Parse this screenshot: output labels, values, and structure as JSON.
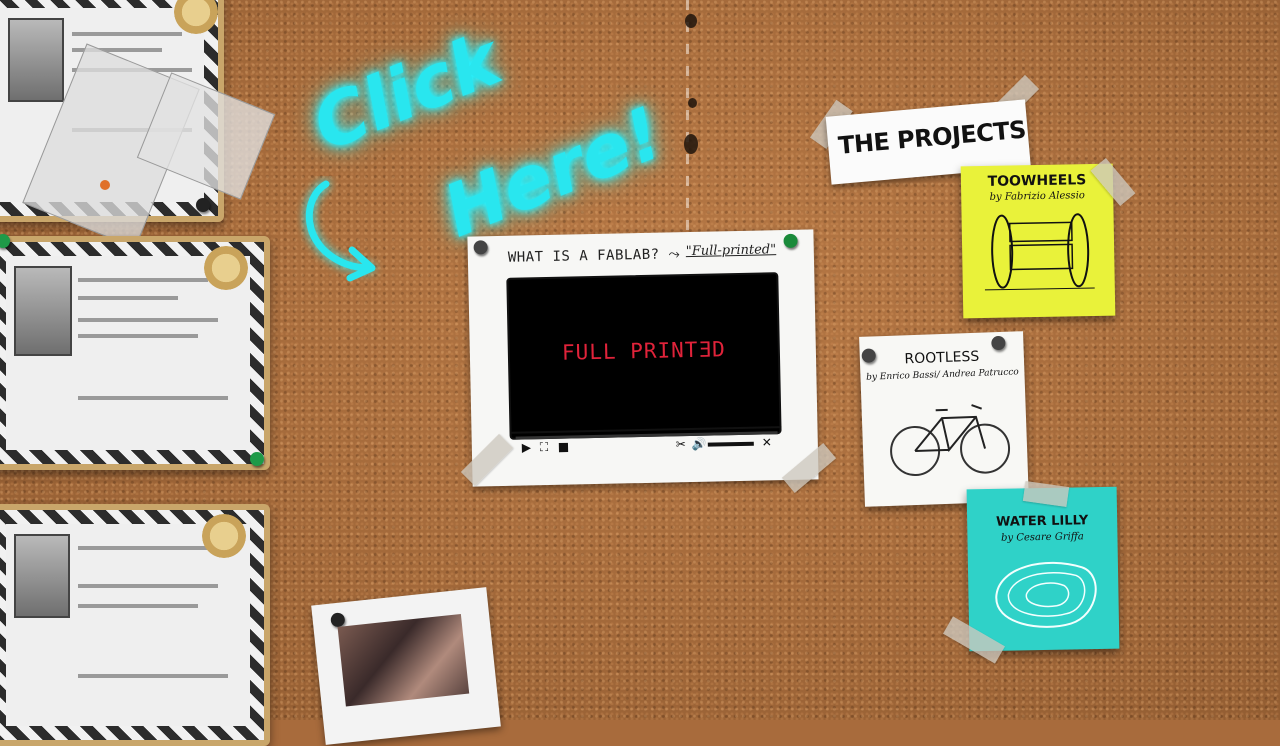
{
  "cta": {
    "line1": "Click",
    "line2": "Here!"
  },
  "video": {
    "title": "WHAT IS A FABLAB?",
    "arrow": "⤳",
    "subtitle": "\"Full-printed\"",
    "screen_text": "FULL PRINTƎD",
    "controls": {
      "play": "▶",
      "fullscreen": "⛶",
      "stop": "■",
      "settings": "✂",
      "volume": "🔊",
      "close": "✕"
    }
  },
  "projects": {
    "heading": "THE PROJECTS",
    "items": [
      {
        "name": "TOOWHEELS",
        "author": "by Fabrizio Alessio",
        "color": "#e9f23a"
      },
      {
        "name": "ROOTLESS",
        "author": "by Enrico Bassi/ Andrea Patrucco",
        "color": "#f8f8f5"
      },
      {
        "name": "WATER LILLY",
        "author": "by Cesare Griffa",
        "color": "#2fd2c8"
      }
    ]
  },
  "colors": {
    "neon": "#29e6ef",
    "cork": "#a86b3c",
    "screen_text": "#e0233a"
  }
}
